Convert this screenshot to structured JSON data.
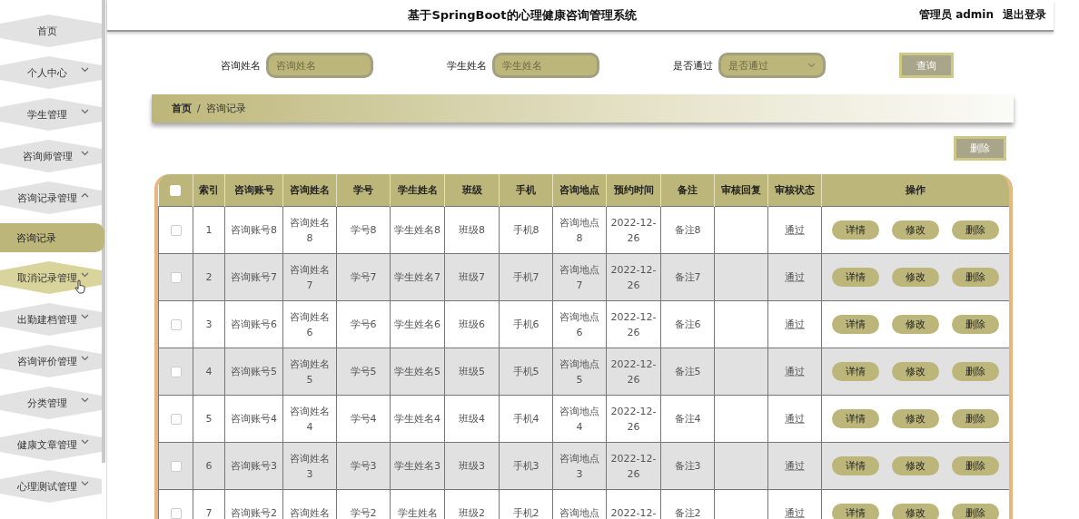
{
  "sidebar": {
    "items": [
      {
        "label": "首页",
        "kind": "home",
        "selected": false,
        "hovered": false
      },
      {
        "label": "个人中心",
        "kind": "menu",
        "expanded": false,
        "selected": false,
        "hovered": false
      },
      {
        "label": "学生管理",
        "kind": "menu",
        "expanded": false,
        "selected": false,
        "hovered": false
      },
      {
        "label": "咨询师管理",
        "kind": "menu",
        "expanded": false,
        "selected": false,
        "hovered": false
      },
      {
        "label": "咨询记录管理",
        "kind": "menu",
        "expanded": true,
        "selected": false,
        "hovered": false
      },
      {
        "label": "咨询记录",
        "kind": "submenu",
        "selected": true,
        "hovered": false
      },
      {
        "label": "取消记录管理",
        "kind": "menu",
        "expanded": false,
        "selected": false,
        "hovered": true
      },
      {
        "label": "出勤建档管理",
        "kind": "menu",
        "expanded": false,
        "selected": false,
        "hovered": false
      },
      {
        "label": "咨询评价管理",
        "kind": "menu",
        "expanded": false,
        "selected": false,
        "hovered": false
      },
      {
        "label": "分类管理",
        "kind": "menu",
        "expanded": false,
        "selected": false,
        "hovered": false
      },
      {
        "label": "健康文章管理",
        "kind": "menu",
        "expanded": false,
        "selected": false,
        "hovered": false
      },
      {
        "label": "心理测试管理",
        "kind": "menu",
        "expanded": false,
        "selected": false,
        "hovered": false
      }
    ]
  },
  "header": {
    "title": "基于SpringBoot的心理健康咨询管理系统",
    "user": "管理员 admin",
    "logout": "退出登录"
  },
  "search": {
    "fields": [
      {
        "label": "咨询姓名",
        "placeholder": "咨询姓名",
        "kind": "input"
      },
      {
        "label": "学生姓名",
        "placeholder": "学生姓名",
        "kind": "input"
      },
      {
        "label": "是否通过",
        "placeholder": "是否通过",
        "kind": "select"
      }
    ],
    "button": "查询"
  },
  "breadcrumb": {
    "home": "首页",
    "separator": "/",
    "current": "咨询记录"
  },
  "delete_button": "删除",
  "table": {
    "header_checked": false,
    "columns": [
      "索引",
      "咨询账号",
      "咨询姓名",
      "学号",
      "学生姓名",
      "班级",
      "手机",
      "咨询地点",
      "预约时间",
      "备注",
      "审核回复",
      "审核状态",
      "操作"
    ],
    "rows": [
      {
        "checked": false,
        "index": "1",
        "account": "咨询账号8",
        "consult_name": "咨询姓名8",
        "student_no": "学号8",
        "student_name": "学生姓名8",
        "class": "班级8",
        "phone": "手机8",
        "location": "咨询地点8",
        "time": "2022-12-26",
        "note": "备注8",
        "status": "通过",
        "actions": [
          "详情",
          "修改",
          "删除"
        ]
      },
      {
        "checked": false,
        "index": "2",
        "account": "咨询账号7",
        "consult_name": "咨询姓名7",
        "student_no": "学号7",
        "student_name": "学生姓名7",
        "class": "班级7",
        "phone": "手机7",
        "location": "咨询地点7",
        "time": "2022-12-26",
        "note": "备注7",
        "status": "通过",
        "actions": [
          "详情",
          "修改",
          "删除"
        ]
      },
      {
        "checked": false,
        "index": "3",
        "account": "咨询账号6",
        "consult_name": "咨询姓名6",
        "student_no": "学号6",
        "student_name": "学生姓名6",
        "class": "班级6",
        "phone": "手机6",
        "location": "咨询地点6",
        "time": "2022-12-26",
        "note": "备注6",
        "status": "通过",
        "actions": [
          "详情",
          "修改",
          "删除"
        ]
      },
      {
        "checked": false,
        "index": "4",
        "account": "咨询账号5",
        "consult_name": "咨询姓名5",
        "student_no": "学号5",
        "student_name": "学生姓名5",
        "class": "班级5",
        "phone": "手机5",
        "location": "咨询地点5",
        "time": "2022-12-26",
        "note": "备注5",
        "status": "通过",
        "actions": [
          "详情",
          "修改",
          "删除"
        ]
      },
      {
        "checked": false,
        "index": "5",
        "account": "咨询账号4",
        "consult_name": "咨询姓名4",
        "student_no": "学号4",
        "student_name": "学生姓名4",
        "class": "班级4",
        "phone": "手机4",
        "location": "咨询地点4",
        "time": "2022-12-26",
        "note": "备注4",
        "status": "通过",
        "actions": [
          "详情",
          "修改",
          "删除"
        ]
      },
      {
        "checked": false,
        "index": "6",
        "account": "咨询账号3",
        "consult_name": "咨询姓名3",
        "student_no": "学号3",
        "student_name": "学生姓名3",
        "class": "班级3",
        "phone": "手机3",
        "location": "咨询地点3",
        "time": "2022-12-26",
        "note": "备注3",
        "status": "通过",
        "actions": [
          "详情",
          "修改",
          "删除"
        ]
      },
      {
        "checked": false,
        "index": "7",
        "account": "咨询账号2",
        "consult_name": "咨询姓名",
        "student_no": "学号2",
        "student_name": "学生姓名",
        "class": "班级2",
        "phone": "手机2",
        "location": "咨询地点",
        "time": "2022-12-",
        "note": "备注2",
        "status": "通过",
        "actions": [
          "详情",
          "修改",
          "删除"
        ]
      }
    ]
  }
}
